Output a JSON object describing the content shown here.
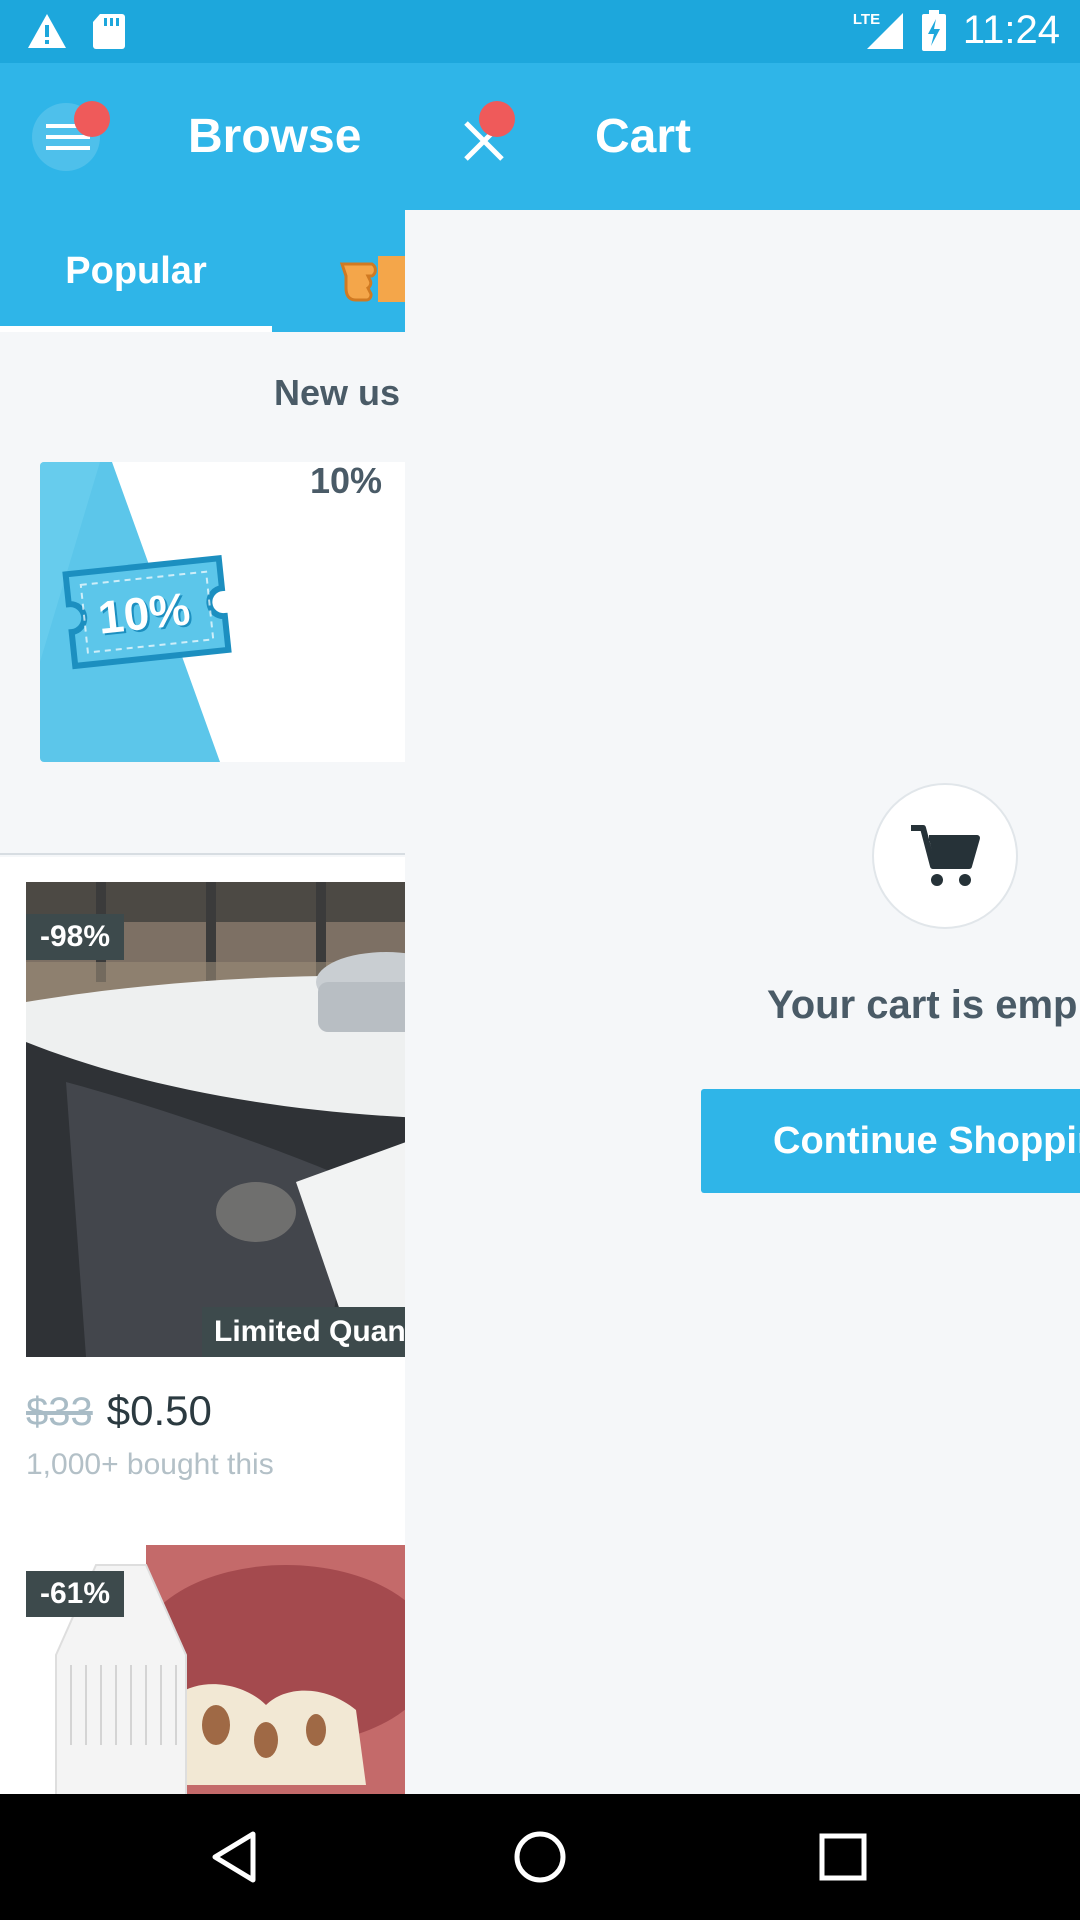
{
  "status_bar": {
    "time": "11:24",
    "network": "LTE",
    "icons": [
      "warning-icon",
      "sd-card-icon",
      "signal-icon",
      "battery-charging-icon"
    ]
  },
  "browse": {
    "title": "Browse",
    "tabs": [
      {
        "label": "Popular",
        "selected": true
      }
    ],
    "promo": {
      "heading": "New us",
      "card_badge": "10%",
      "card_text": "10%"
    },
    "products": [
      {
        "discount": "-98%",
        "label": "Limited Quanti",
        "price_old": "$33",
        "price_new": "$0.50",
        "bought": "1,000+ bought this"
      },
      {
        "discount": "-61%"
      }
    ]
  },
  "cart": {
    "title": "Cart",
    "empty_text": "Your cart is emp",
    "continue_label": "Continue Shoppin"
  },
  "colors": {
    "primary": "#2fb5e8",
    "status_bar": "#1da7dc",
    "badge_red": "#ef5a5a",
    "text_dark": "#4a5b67"
  }
}
